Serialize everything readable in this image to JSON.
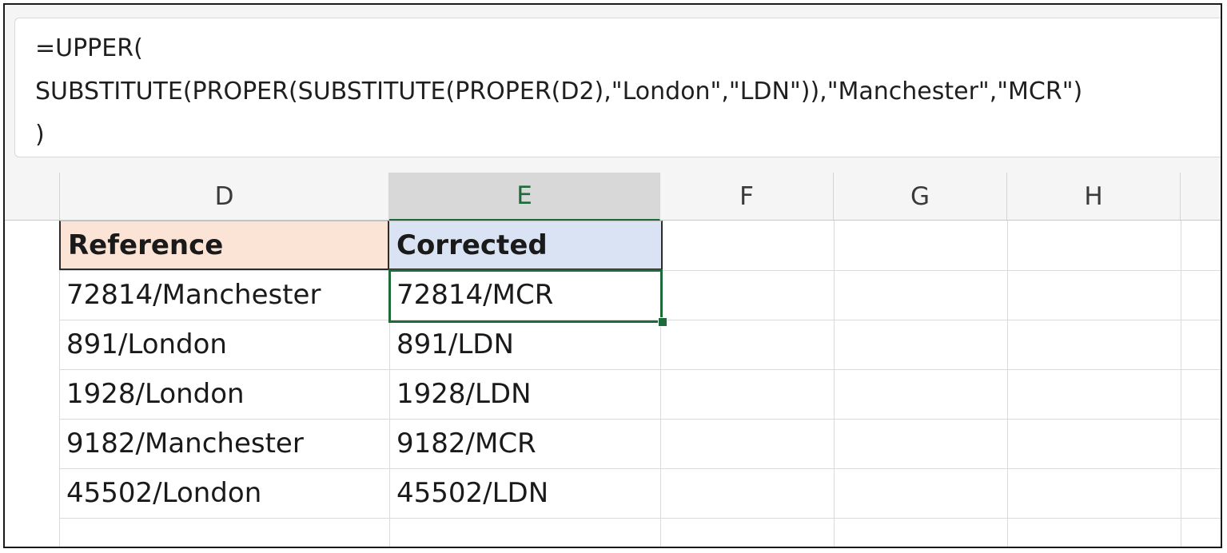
{
  "formula_bar": {
    "line1": "=UPPER(",
    "line2": "SUBSTITUTE(PROPER(SUBSTITUTE(PROPER(D2),\"London\",\"LDN\")),\"Manchester\",\"MCR\")",
    "line3": ")"
  },
  "columns": [
    "D",
    "E",
    "F",
    "G",
    "H"
  ],
  "active_column": "E",
  "colors": {
    "accent_green": "#1e6b3a",
    "header_d_fill": "#fbe4d5",
    "header_e_fill": "#dae3f3"
  },
  "table": {
    "headers": [
      "Reference",
      "Corrected"
    ],
    "rows": [
      [
        "72814/Manchester",
        "72814/MCR"
      ],
      [
        "891/London",
        "891/LDN"
      ],
      [
        "1928/London",
        "1928/LDN"
      ],
      [
        "9182/Manchester",
        "9182/MCR"
      ],
      [
        "45502/London",
        "45502/LDN"
      ]
    ]
  }
}
